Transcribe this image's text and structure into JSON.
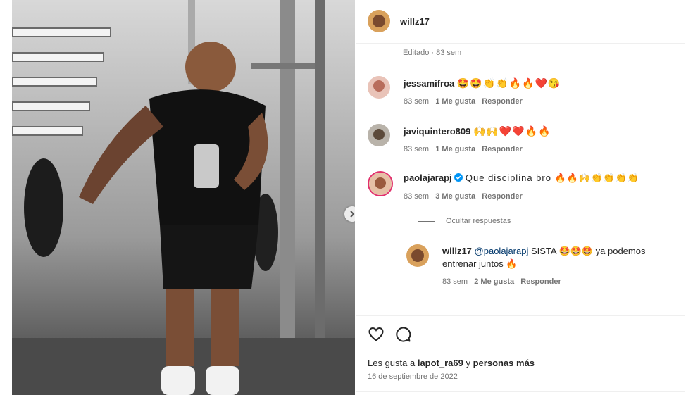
{
  "post": {
    "author": "willz17",
    "edited": "Edditado · 83 sem",
    "likes_prefix": "Les gusta a ",
    "likes_user": "lapot_ra69",
    "likes_middle": " y ",
    "likes_suffix": "personas más",
    "date": "16 de septiembre de 2022"
  },
  "comments": [
    {
      "user": "jessamifroa",
      "text": "🤩🤩👏👏🔥🔥❤️😘",
      "time": "83 sem",
      "likes": "1 Me gusta",
      "reply": "Responder"
    },
    {
      "user": "javiquintero809",
      "text": "🙌🙌❤️❤️🔥🔥",
      "time": "83 sem",
      "likes": "1 Me gusta",
      "reply": "Responder"
    },
    {
      "user": "paolajarapj",
      "text": "Que disciplina bro 🔥🔥🙌👏👏👏👏",
      "time": "83 sem",
      "likes": "3 Me gusta",
      "reply": "Responder"
    }
  ],
  "hide_replies": "Ocultar respuestas",
  "reply": {
    "user": "willz17",
    "mention": "@paolajarapj",
    "text_line1": " SISTA 🤩🤩🤩 ya podemos",
    "text_line2": "entrenar juntos 🔥",
    "time": "83 sem",
    "likes": "2 Me gusta",
    "reply": "Responder"
  },
  "icons": {
    "like": "heart-icon",
    "comment": "comment-icon",
    "next": "chevron-right-icon",
    "verified": "verified-badge-icon"
  },
  "colors": {
    "link": "#00376b",
    "verified": "#0095f6",
    "muted": "#737373"
  }
}
